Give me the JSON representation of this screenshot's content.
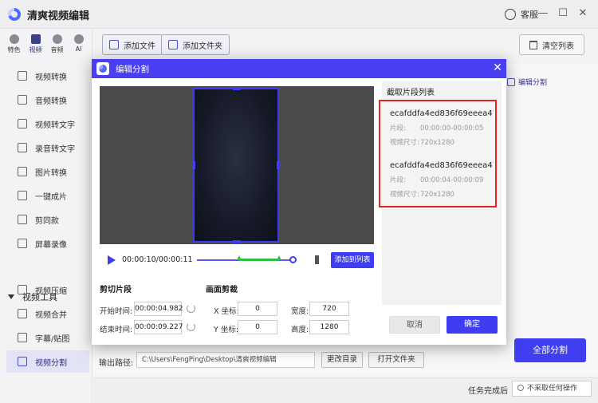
{
  "app": {
    "title": "清爽视频编辑",
    "support": "客服"
  },
  "window_controls": {
    "minimize": "—",
    "restore": "☐",
    "close": "✕"
  },
  "categories": [
    {
      "label": "特色"
    },
    {
      "label": "视频"
    },
    {
      "label": "音频"
    },
    {
      "label": "AI"
    }
  ],
  "nav": {
    "items": [
      {
        "label": "视频转换"
      },
      {
        "label": "音频转换"
      },
      {
        "label": "视频转文字"
      },
      {
        "label": "录音转文字"
      },
      {
        "label": "图片转换"
      },
      {
        "label": "一键成片"
      },
      {
        "label": "剪同款"
      },
      {
        "label": "屏幕录像"
      }
    ],
    "section_title": "视频工具",
    "tool_items": [
      {
        "label": "视频压缩"
      },
      {
        "label": "视频合并"
      },
      {
        "label": "字幕/贴图"
      },
      {
        "label": "视频分割"
      }
    ]
  },
  "toolbar": {
    "add_file": "添加文件",
    "add_folder": "添加文件夹",
    "clear_list": "清空列表"
  },
  "main": {
    "edit_split": "编辑分割",
    "split_all": "全部分割"
  },
  "output": {
    "label": "输出路径:",
    "path": "C:\\Users\\FengPing\\Desktop\\清爽视频编辑",
    "change_dir": "更改目录",
    "open_folder": "打开文件夹"
  },
  "bottom": {
    "task_label": "任务完成后",
    "task_option": "不采取任何操作"
  },
  "dialog": {
    "title": "编辑分割",
    "close": "✕",
    "player": {
      "time": "00:00:10/00:00:11",
      "add_to_list": "添加到列表"
    },
    "cut_section": {
      "title": "剪切片段",
      "start_label": "开始时间:",
      "start_value": "00:00:04.982",
      "end_label": "结束时间:",
      "end_value": "00:00:09.227"
    },
    "crop_section": {
      "title": "画面剪裁",
      "x_label": "X 坐标:",
      "x_value": "0",
      "y_label": "Y 坐标:",
      "y_value": "0",
      "width_label": "宽度:",
      "width_value": "720",
      "height_label": "高度:",
      "height_value": "1280"
    },
    "clips_title": "截取片段列表",
    "clips": [
      {
        "name": "ecafddfa4ed836f69eeea478 ...",
        "segment_label": "片段:",
        "segment": "00:00:00-00:00:05",
        "size_label": "视频尺寸:",
        "size": "720x1280"
      },
      {
        "name": "ecafddfa4ed836f69eeea478 ...",
        "segment_label": "片段:",
        "segment": "00:00:04-00:00:09",
        "size_label": "视频尺寸:",
        "size": "720x1280"
      }
    ],
    "cancel": "取消",
    "confirm": "确定"
  },
  "colors": {
    "accent": "#3e3ef0",
    "highlight_border": "#e52521",
    "progress_selected": "#2fc043"
  }
}
